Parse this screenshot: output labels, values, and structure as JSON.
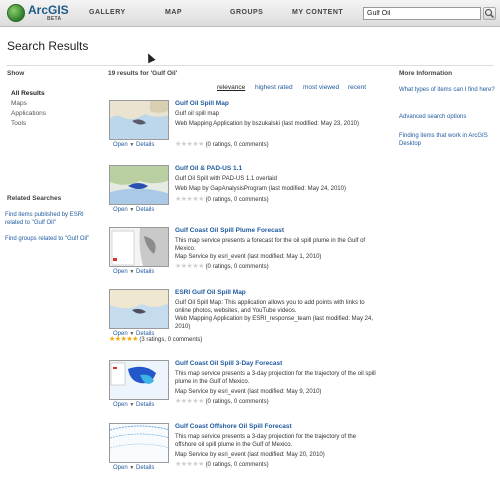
{
  "app": {
    "logo": "ArcGIS",
    "badge": "BETA"
  },
  "nav": [
    "GALLERY",
    "MAP",
    "GROUPS",
    "MY CONTENT"
  ],
  "search": {
    "value": "Gulf Oil"
  },
  "page_title": "Search Results",
  "show": {
    "heading": "Show",
    "items": [
      "All Results",
      "Maps",
      "Applications",
      "Tools"
    ]
  },
  "related": {
    "heading": "Related Searches",
    "links": [
      "Find items published by ESRI related to \"Gulf Oil\"",
      "Find groups related to \"Gulf Oil\""
    ]
  },
  "results_count": "19 results for 'Gulf Oil'",
  "sort": [
    "relevance",
    "highest rated",
    "most viewed",
    "recent"
  ],
  "more_info": {
    "heading": "More Information",
    "links": [
      "What types of items can I find here?",
      "Advanced search options",
      "Finding items that work in ArcGIS Desktop"
    ]
  },
  "actions": {
    "open": "Open",
    "details": "Details"
  },
  "results": [
    {
      "title": "Gulf Oil Spill Map",
      "desc": "Gulf oil spill map",
      "meta": "Web Mapping Application by bszukalski (last modified: May 23, 2010)",
      "rating": "(0 ratings, 0 comments)"
    },
    {
      "title": "Gulf Oil & PAD-US 1.1",
      "desc": "Gulf Oil Spill with PAD-US 1.1 overlaid",
      "meta": "Web Map by GapAnalysisProgram (last modified: May 24, 2010)",
      "rating": "(0 ratings, 0 comments)"
    },
    {
      "title": "Gulf Coast Oil Spill Plume Forecast",
      "desc": "This map service presents a forecast for the oil spill plume in the Gulf of Mexico.",
      "meta": "Map Service by esri_event (last modified: May 1, 2010)",
      "rating": "(0 ratings, 0 comments)"
    },
    {
      "title": "ESRI Gulf Oil Spill Map",
      "desc": "Gulf Oil Spill Map: This application allows you to add points with links to online photos, websites, and YouTube videos.",
      "meta": "Web Mapping Application by ESRI_response_team (last modified: May 24, 2010)",
      "rating": "(3 ratings, 0 comments)",
      "stars": 4.5
    },
    {
      "title": "Gulf Coast Oil Spill 3-Day Forecast",
      "desc": "This map service presents a 3-day projection for the trajectory of the oil spill plume in the Gulf of Mexico.",
      "meta": "Map Service by esri_event (last modified: May 9, 2010)",
      "rating": "(0 ratings, 0 comments)"
    },
    {
      "title": "Gulf Coast Offshore Oil Spill Forecast",
      "desc": "This map service presents a 3-day projection for the trajectory of the offshore oil spill plume in the Gulf of Mexico.",
      "meta": "Map Service by esri_event (last modified: May 20, 2010)",
      "rating": "(0 ratings, 0 comments)"
    }
  ]
}
